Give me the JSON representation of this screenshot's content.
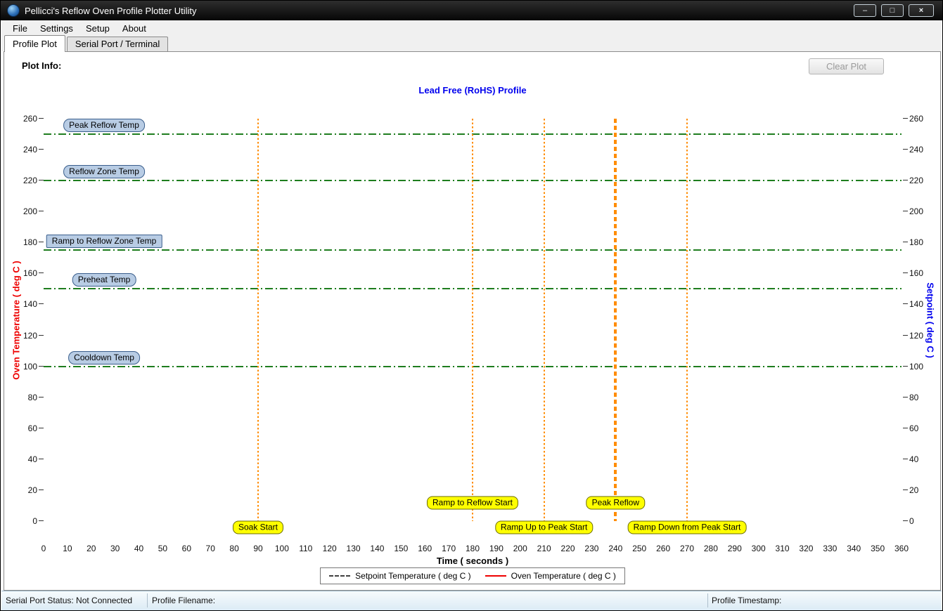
{
  "window": {
    "title": "Pellicci's Reflow Oven Profile Plotter Utility",
    "controls": {
      "minimize_glyph": "–",
      "maximize_glyph": "□",
      "close_glyph": "×"
    }
  },
  "menu": {
    "items": [
      "File",
      "Settings",
      "Setup",
      "About"
    ]
  },
  "tabs": [
    {
      "label": "Profile Plot",
      "active": true
    },
    {
      "label": "Serial Port / Terminal",
      "active": false
    }
  ],
  "panel": {
    "plot_info_label": "Plot Info:",
    "clear_plot_label": "Clear Plot",
    "clear_plot_enabled": false
  },
  "chart_data": {
    "type": "line",
    "title": "Lead Free (RoHS) Profile",
    "xlabel": "Time ( seconds )",
    "ylabel_left": "Oven Temperature ( deg C )",
    "ylabel_right": "Setpoint ( deg C )",
    "xlim": [
      0,
      360
    ],
    "x_tick_step": 10,
    "ylim": [
      0,
      260
    ],
    "y_tick_step": 20,
    "grid": false,
    "series": [],
    "callout_center_time": 25.4,
    "setpoint_lines": [
      {
        "label": "Peak Reflow Temp",
        "temp": 250,
        "shape": "rounded"
      },
      {
        "label": "Reflow Zone Temp",
        "temp": 220,
        "shape": "rounded"
      },
      {
        "label": "Ramp to Reflow Zone Temp",
        "temp": 175,
        "shape": "square"
      },
      {
        "label": "Preheat Temp",
        "temp": 150,
        "shape": "rounded"
      },
      {
        "label": "Cooldown Temp",
        "temp": 100,
        "shape": "rounded"
      }
    ],
    "time_markers": [
      {
        "label": "Soak Start",
        "time": 90,
        "label_temp": -4,
        "emphasis": false
      },
      {
        "label": "Ramp to Reflow Start",
        "time": 180,
        "label_temp": 12,
        "emphasis": false
      },
      {
        "label": "Ramp Up to Peak Start",
        "time": 210,
        "label_temp": -4,
        "emphasis": false
      },
      {
        "label": "Peak Reflow",
        "time": 240,
        "label_temp": 12,
        "emphasis": true
      },
      {
        "label": "Ramp Down from Peak Start",
        "time": 270,
        "label_temp": -4,
        "emphasis": false
      }
    ],
    "legend": [
      {
        "label": "Setpoint Temperature ( deg C )",
        "color": "#404040",
        "style": "dashed"
      },
      {
        "label": "Oven Temperature ( deg C )",
        "color": "#ee0000",
        "style": "solid"
      }
    ],
    "colors": {
      "title": "#0000ee",
      "oven_axis": "#ee0000",
      "setpoint_axis": "#0000ee",
      "setpoint_line": "#1e7d1e",
      "marker_line": "#ff8c00",
      "callout_fill": "#b8cce4",
      "callout_border": "#3a5e8c",
      "flag_fill": "#ffff00",
      "flag_border": "#6b6b00"
    }
  },
  "status_bar": {
    "serial_status": "Serial Port Status: Not Connected",
    "profile_filename": "Profile Filename:",
    "profile_timestamp": "Profile Timestamp:"
  }
}
